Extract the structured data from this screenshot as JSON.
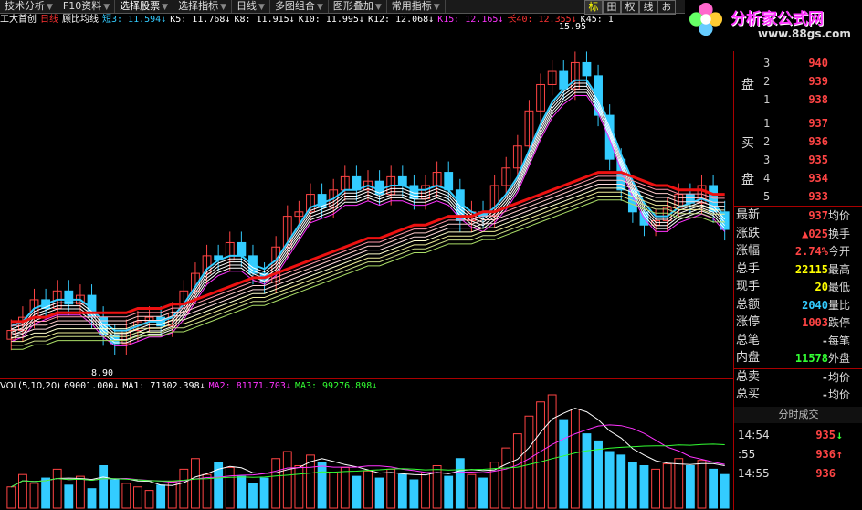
{
  "toolbar": {
    "items": [
      "技术分析",
      "F10资料",
      "选择股票",
      "选择指标",
      "日线",
      "多图组合",
      "图形叠加",
      "常用指标"
    ],
    "right_buttons": [
      "标",
      "田",
      "权",
      "线",
      "お"
    ]
  },
  "legend": {
    "stock_name": "工大首创",
    "period": "日线",
    "indicator": "顾比均线",
    "items": [
      {
        "text": "短3: 11.594↓",
        "color": "#3cf"
      },
      {
        "text": "K5: 11.768↓",
        "color": "#fff"
      },
      {
        "text": "K8: 11.915↓",
        "color": "#fff"
      },
      {
        "text": "K10: 11.995↓",
        "color": "#fff"
      },
      {
        "text": "K12: 12.068↓",
        "color": "#fff"
      },
      {
        "text": "K15: 12.165↓",
        "color": "#f3f"
      },
      {
        "text": "长40: 12.355↓",
        "color": "#f33"
      },
      {
        "text": "K45: 1",
        "color": "#fff"
      }
    ]
  },
  "logo": {
    "brand": "分析家公式网",
    "url": "www.88gs.com"
  },
  "price_labels": {
    "high": "15.95",
    "low": "8.90"
  },
  "volume_legend": {
    "label": "VOL(5,10,20)",
    "items": [
      {
        "text": "69001.000↓",
        "color": "#fff"
      },
      {
        "text": "MA1: 71302.398↓",
        "color": "#fff"
      },
      {
        "text": "MA2: 81171.703↓",
        "color": "#f3f"
      },
      {
        "text": "MA3: 99276.898↓",
        "color": "#3f3"
      }
    ]
  },
  "order_book": {
    "sell_label_1": "盘",
    "buy_label_1": "买",
    "buy_label_2": "盘",
    "sell": [
      {
        "level": "3",
        "price": "940"
      },
      {
        "level": "2",
        "price": "939"
      },
      {
        "level": "1",
        "price": "938"
      }
    ],
    "buy": [
      {
        "level": "1",
        "price": "937"
      },
      {
        "level": "2",
        "price": "936"
      },
      {
        "level": "3",
        "price": "935"
      },
      {
        "level": "4",
        "price": "934"
      },
      {
        "level": "5",
        "price": "933"
      }
    ]
  },
  "quote": [
    {
      "label": "最新",
      "value": "937",
      "color": "#f44",
      "label2": "均价"
    },
    {
      "label": "涨跌",
      "value": "▲025",
      "color": "#f44",
      "label2": "换手"
    },
    {
      "label": "涨幅",
      "value": "2.74%",
      "color": "#f44",
      "label2": "今开"
    },
    {
      "label": "总手",
      "value": "22115",
      "color": "#ff0",
      "label2": "最高"
    },
    {
      "label": "现手",
      "value": "20",
      "color": "#ff0",
      "label2": "最低"
    },
    {
      "label": "总额",
      "value": "2040",
      "color": "#3cf",
      "label2": "量比"
    },
    {
      "label": "涨停",
      "value": "1003",
      "color": "#f44",
      "label2": "跌停"
    },
    {
      "label": "总笔",
      "value": "-",
      "color": "#ccc",
      "label2": "每笔"
    },
    {
      "label": "内盘",
      "value": "11578",
      "color": "#3f3",
      "label2": "外盘"
    },
    {
      "label": "总卖",
      "value": "-",
      "color": "#ccc",
      "label2": "均价"
    },
    {
      "label": "总买",
      "value": "-",
      "color": "#ccc",
      "label2": "均价"
    }
  ],
  "ticks": {
    "header": "分时成交",
    "rows": [
      {
        "time": "14:54",
        "price": "935",
        "dir": "↓",
        "color": "#f44",
        "dircolor": "#3f3"
      },
      {
        "time": ":55",
        "price": "936",
        "dir": "↑",
        "color": "#f44",
        "dircolor": "#f44"
      },
      {
        "time": "14:55",
        "price": "936",
        "dir": "",
        "color": "#f44",
        "dircolor": "#f44"
      }
    ]
  },
  "colors": {
    "up": "#f44",
    "down": "#3cf",
    "ma_short": "#3cf",
    "ma_long": "#e11",
    "divider": "#a00"
  },
  "chart_data": {
    "type": "line",
    "title": "",
    "xlabel": "",
    "ylabel": "",
    "close": [
      9.3,
      9.6,
      10.0,
      9.8,
      10.2,
      9.9,
      10.1,
      9.6,
      9.2,
      9.0,
      9.3,
      9.5,
      9.6,
      9.4,
      9.7,
      10.2,
      10.6,
      11.0,
      10.9,
      11.3,
      11.0,
      10.6,
      10.4,
      11.2,
      11.9,
      12.0,
      12.4,
      12.1,
      12.5,
      12.8,
      12.5,
      12.7,
      12.4,
      12.8,
      12.6,
      12.3,
      12.6,
      12.9,
      12.5,
      11.8,
      12.0,
      11.9,
      12.6,
      13.0,
      13.5,
      14.3,
      14.9,
      15.2,
      14.8,
      15.4,
      15.1,
      14.2,
      13.2,
      12.5,
      12.0,
      11.7,
      11.8,
      12.1,
      12.4,
      12.2,
      12.6,
      12.0,
      11.6
    ],
    "ma_short": [
      9.4,
      9.5,
      9.8,
      9.9,
      10.0,
      10.0,
      10.0,
      9.8,
      9.5,
      9.3,
      9.3,
      9.4,
      9.5,
      9.5,
      9.6,
      9.9,
      10.3,
      10.7,
      10.9,
      11.0,
      11.0,
      10.8,
      10.7,
      10.9,
      11.3,
      11.7,
      12.1,
      12.2,
      12.3,
      12.5,
      12.5,
      12.6,
      12.5,
      12.6,
      12.6,
      12.5,
      12.5,
      12.6,
      12.5,
      12.2,
      12.0,
      11.9,
      12.1,
      12.4,
      12.8,
      13.4,
      14.0,
      14.5,
      14.8,
      15.0,
      15.0,
      14.6,
      14.0,
      13.3,
      12.7,
      12.2,
      11.9,
      11.9,
      12.1,
      12.2,
      12.3,
      12.2,
      11.9
    ],
    "ma_long": [
      9.5,
      9.5,
      9.6,
      9.6,
      9.7,
      9.7,
      9.7,
      9.7,
      9.7,
      9.7,
      9.7,
      9.8,
      9.8,
      9.8,
      9.9,
      9.9,
      10.0,
      10.1,
      10.2,
      10.3,
      10.4,
      10.5,
      10.5,
      10.6,
      10.7,
      10.8,
      10.9,
      11.0,
      11.1,
      11.2,
      11.3,
      11.4,
      11.4,
      11.5,
      11.6,
      11.7,
      11.7,
      11.8,
      11.9,
      11.9,
      11.9,
      12.0,
      12.0,
      12.1,
      12.2,
      12.3,
      12.4,
      12.5,
      12.6,
      12.7,
      12.8,
      12.9,
      12.9,
      12.9,
      12.8,
      12.7,
      12.6,
      12.6,
      12.5,
      12.5,
      12.5,
      12.4,
      12.4
    ],
    "volume": [
      60,
      95,
      70,
      85,
      110,
      65,
      90,
      55,
      120,
      80,
      70,
      60,
      50,
      65,
      75,
      110,
      140,
      95,
      130,
      115,
      90,
      70,
      85,
      140,
      160,
      120,
      150,
      130,
      100,
      115,
      90,
      105,
      85,
      110,
      95,
      80,
      100,
      120,
      90,
      140,
      95,
      85,
      130,
      170,
      210,
      260,
      300,
      320,
      250,
      280,
      210,
      190,
      160,
      150,
      130,
      120,
      110,
      125,
      140,
      120,
      135,
      110,
      95
    ],
    "ylim": [
      8.5,
      16.2
    ],
    "grid": false
  }
}
